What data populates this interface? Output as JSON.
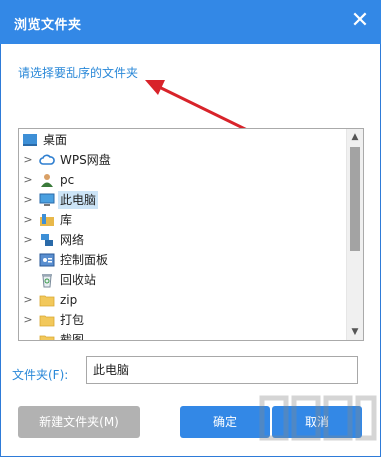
{
  "dialog": {
    "title": "浏览文件夹",
    "close_glyph": "✕",
    "prompt": "请选择要乱序的文件夹"
  },
  "tree": {
    "items": [
      {
        "label": "桌面",
        "icon": "desktop-icon",
        "expandable": false,
        "selected": false
      },
      {
        "label": "WPS网盘",
        "icon": "cloud-icon",
        "expandable": true,
        "selected": false
      },
      {
        "label": "pc",
        "icon": "user-icon",
        "expandable": true,
        "selected": false
      },
      {
        "label": "此电脑",
        "icon": "computer-icon",
        "expandable": true,
        "selected": true
      },
      {
        "label": "库",
        "icon": "library-icon",
        "expandable": true,
        "selected": false
      },
      {
        "label": "网络",
        "icon": "network-icon",
        "expandable": true,
        "selected": false
      },
      {
        "label": "控制面板",
        "icon": "control-panel-icon",
        "expandable": true,
        "selected": false
      },
      {
        "label": "回收站",
        "icon": "recycle-bin-icon",
        "expandable": false,
        "selected": false
      },
      {
        "label": "zip",
        "icon": "folder-icon",
        "expandable": true,
        "selected": false
      },
      {
        "label": "打包",
        "icon": "folder-icon",
        "expandable": true,
        "selected": false
      },
      {
        "label": "截图",
        "icon": "folder-icon",
        "expandable": false,
        "selected": false
      }
    ]
  },
  "folder_field": {
    "label": "文件夹(F):",
    "value": "此电脑"
  },
  "buttons": {
    "new_folder": "新建文件夹(M)",
    "ok": "确定",
    "cancel": "取消"
  },
  "colors": {
    "accent": "#3388e6",
    "link": "#2a88d8",
    "arrow": "#d8232a",
    "selection": "#cce4f7"
  }
}
